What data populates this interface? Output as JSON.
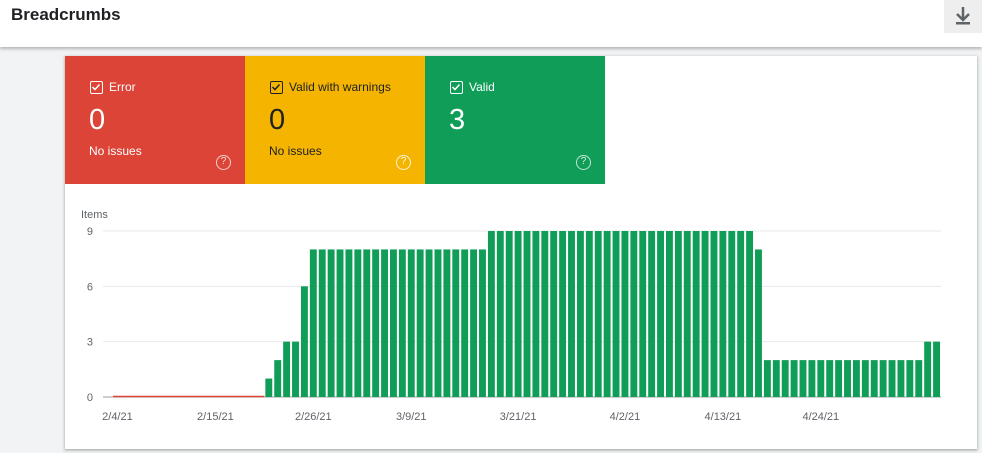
{
  "header": {
    "title": "Breadcrumbs",
    "download_icon": "download-icon"
  },
  "tiles": {
    "error": {
      "label": "Error",
      "count": "0",
      "sub": "No issues",
      "color": "#db4437"
    },
    "warnings": {
      "label": "Valid with warnings",
      "count": "0",
      "sub": "No issues",
      "color": "#f4b400"
    },
    "valid": {
      "label": "Valid",
      "count": "3",
      "sub": "",
      "color": "#0f9d58"
    }
  },
  "chart_data": {
    "type": "bar",
    "ylabel": "Items",
    "ylim": [
      0,
      9
    ],
    "yticks": [
      0,
      3,
      6,
      9
    ],
    "x_tick_labels": [
      "2/4/21",
      "2/15/21",
      "2/26/21",
      "3/9/21",
      "3/21/21",
      "4/2/21",
      "4/13/21",
      "4/24/21"
    ],
    "x_tick_day_index": [
      0,
      11,
      22,
      33,
      45,
      57,
      68,
      79
    ],
    "grid": true,
    "series": [
      {
        "color": "#0f9d58",
        "values": [
          0,
          0,
          0,
          0,
          0,
          0,
          0,
          0,
          0,
          0,
          0,
          0,
          0,
          0,
          0,
          0,
          0,
          1,
          2,
          3,
          3,
          6,
          8,
          8,
          8,
          8,
          8,
          8,
          8,
          8,
          8,
          8,
          8,
          8,
          8,
          8,
          8,
          8,
          8,
          8,
          8,
          8,
          9,
          9,
          9,
          9,
          9,
          9,
          9,
          9,
          9,
          9,
          9,
          9,
          9,
          9,
          9,
          9,
          9,
          9,
          9,
          9,
          9,
          9,
          9,
          9,
          9,
          9,
          9,
          9,
          9,
          9,
          8,
          2,
          2,
          2,
          2,
          2,
          2,
          2,
          2,
          2,
          2,
          2,
          2,
          2,
          2,
          2,
          2,
          2,
          2,
          3,
          3
        ]
      },
      {
        "color": "#db4437",
        "values": [
          0,
          0,
          0,
          0,
          0,
          0,
          0,
          0,
          0,
          0,
          0,
          0,
          0,
          0,
          0,
          0,
          0,
          0,
          0,
          0,
          0,
          0,
          0,
          0,
          0,
          0,
          0,
          0,
          0,
          0,
          0,
          0,
          0,
          0,
          0,
          0,
          0,
          0,
          0,
          0,
          0,
          0,
          0,
          0,
          0,
          0,
          0,
          0,
          0,
          0,
          0,
          0,
          0,
          0,
          0,
          0,
          0,
          0,
          0,
          0,
          0,
          0,
          0,
          0,
          0,
          0,
          0,
          0,
          0,
          0,
          0,
          0,
          0,
          0,
          0,
          0,
          0,
          0,
          0,
          0,
          0,
          0,
          0,
          0,
          0,
          0,
          0,
          0,
          0,
          0,
          0,
          0,
          0
        ]
      }
    ]
  }
}
